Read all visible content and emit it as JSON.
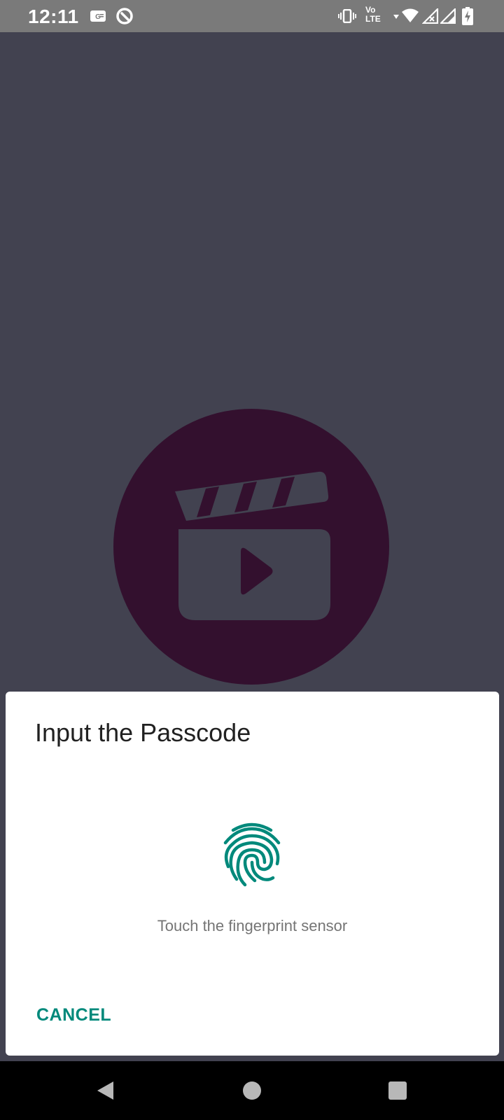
{
  "status_bar": {
    "time": "12:11",
    "volte_top": "Vo",
    "volte_bottom": "LTE",
    "icons": [
      "gmail-box-icon",
      "vpn-circle-icon",
      "vibrate-icon",
      "volte-icon",
      "data-arrow-icon",
      "wifi-icon",
      "signal-x-icon",
      "signal-icon",
      "battery-charging-icon"
    ]
  },
  "splash": {
    "logo": "clapperboard-play-icon",
    "logo_color": "#33102e"
  },
  "dialog": {
    "title": "Input the Passcode",
    "icon": "fingerprint-icon",
    "message": "Touch the fingerprint sensor",
    "cancel_label": "CANCEL",
    "accent_color": "#00897b"
  },
  "nav_bar": {
    "buttons": [
      "back-icon",
      "home-icon",
      "recents-icon"
    ]
  }
}
